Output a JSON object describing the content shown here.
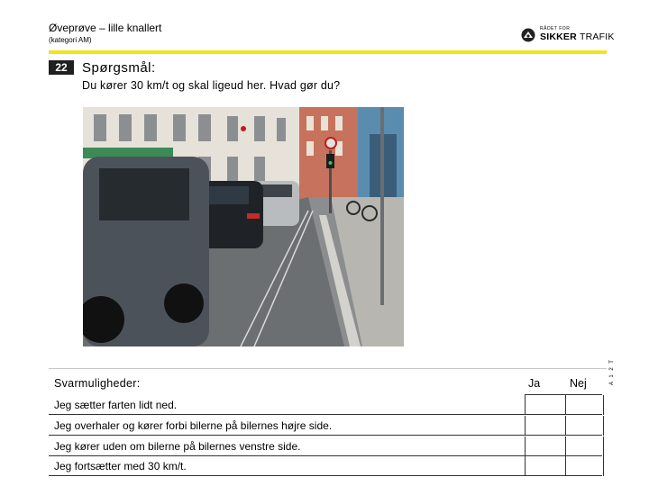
{
  "header": {
    "title": "Øveprøve – lille knallert",
    "subtitle": "(kategori AM)"
  },
  "logo": {
    "small_text": "RÅDET FOR",
    "brand_bold": "SIKKER",
    "brand_light": "TRAFIK"
  },
  "question": {
    "number": "22",
    "label": "Spørgsmål:",
    "text": "Du kører 30 km/t og skal ligeud her. Hvad gør du?"
  },
  "image": {
    "icon": "street-photo"
  },
  "side_code": "A 1 2 T",
  "answers": {
    "heading": "Svarmuligheder:",
    "col_yes": "Ja",
    "col_no": "Nej",
    "items": [
      {
        "text": "Jeg sætter farten lidt ned."
      },
      {
        "text": "Jeg overhaler og kører forbi bilerne på bilernes højre side."
      },
      {
        "text": "Jeg kører uden om bilerne på bilernes venstre side."
      },
      {
        "text": "Jeg fortsætter med 30 km/t."
      }
    ]
  },
  "colors": {
    "accent_yellow": "#f5e31a",
    "badge_dark": "#1f1f1f"
  }
}
